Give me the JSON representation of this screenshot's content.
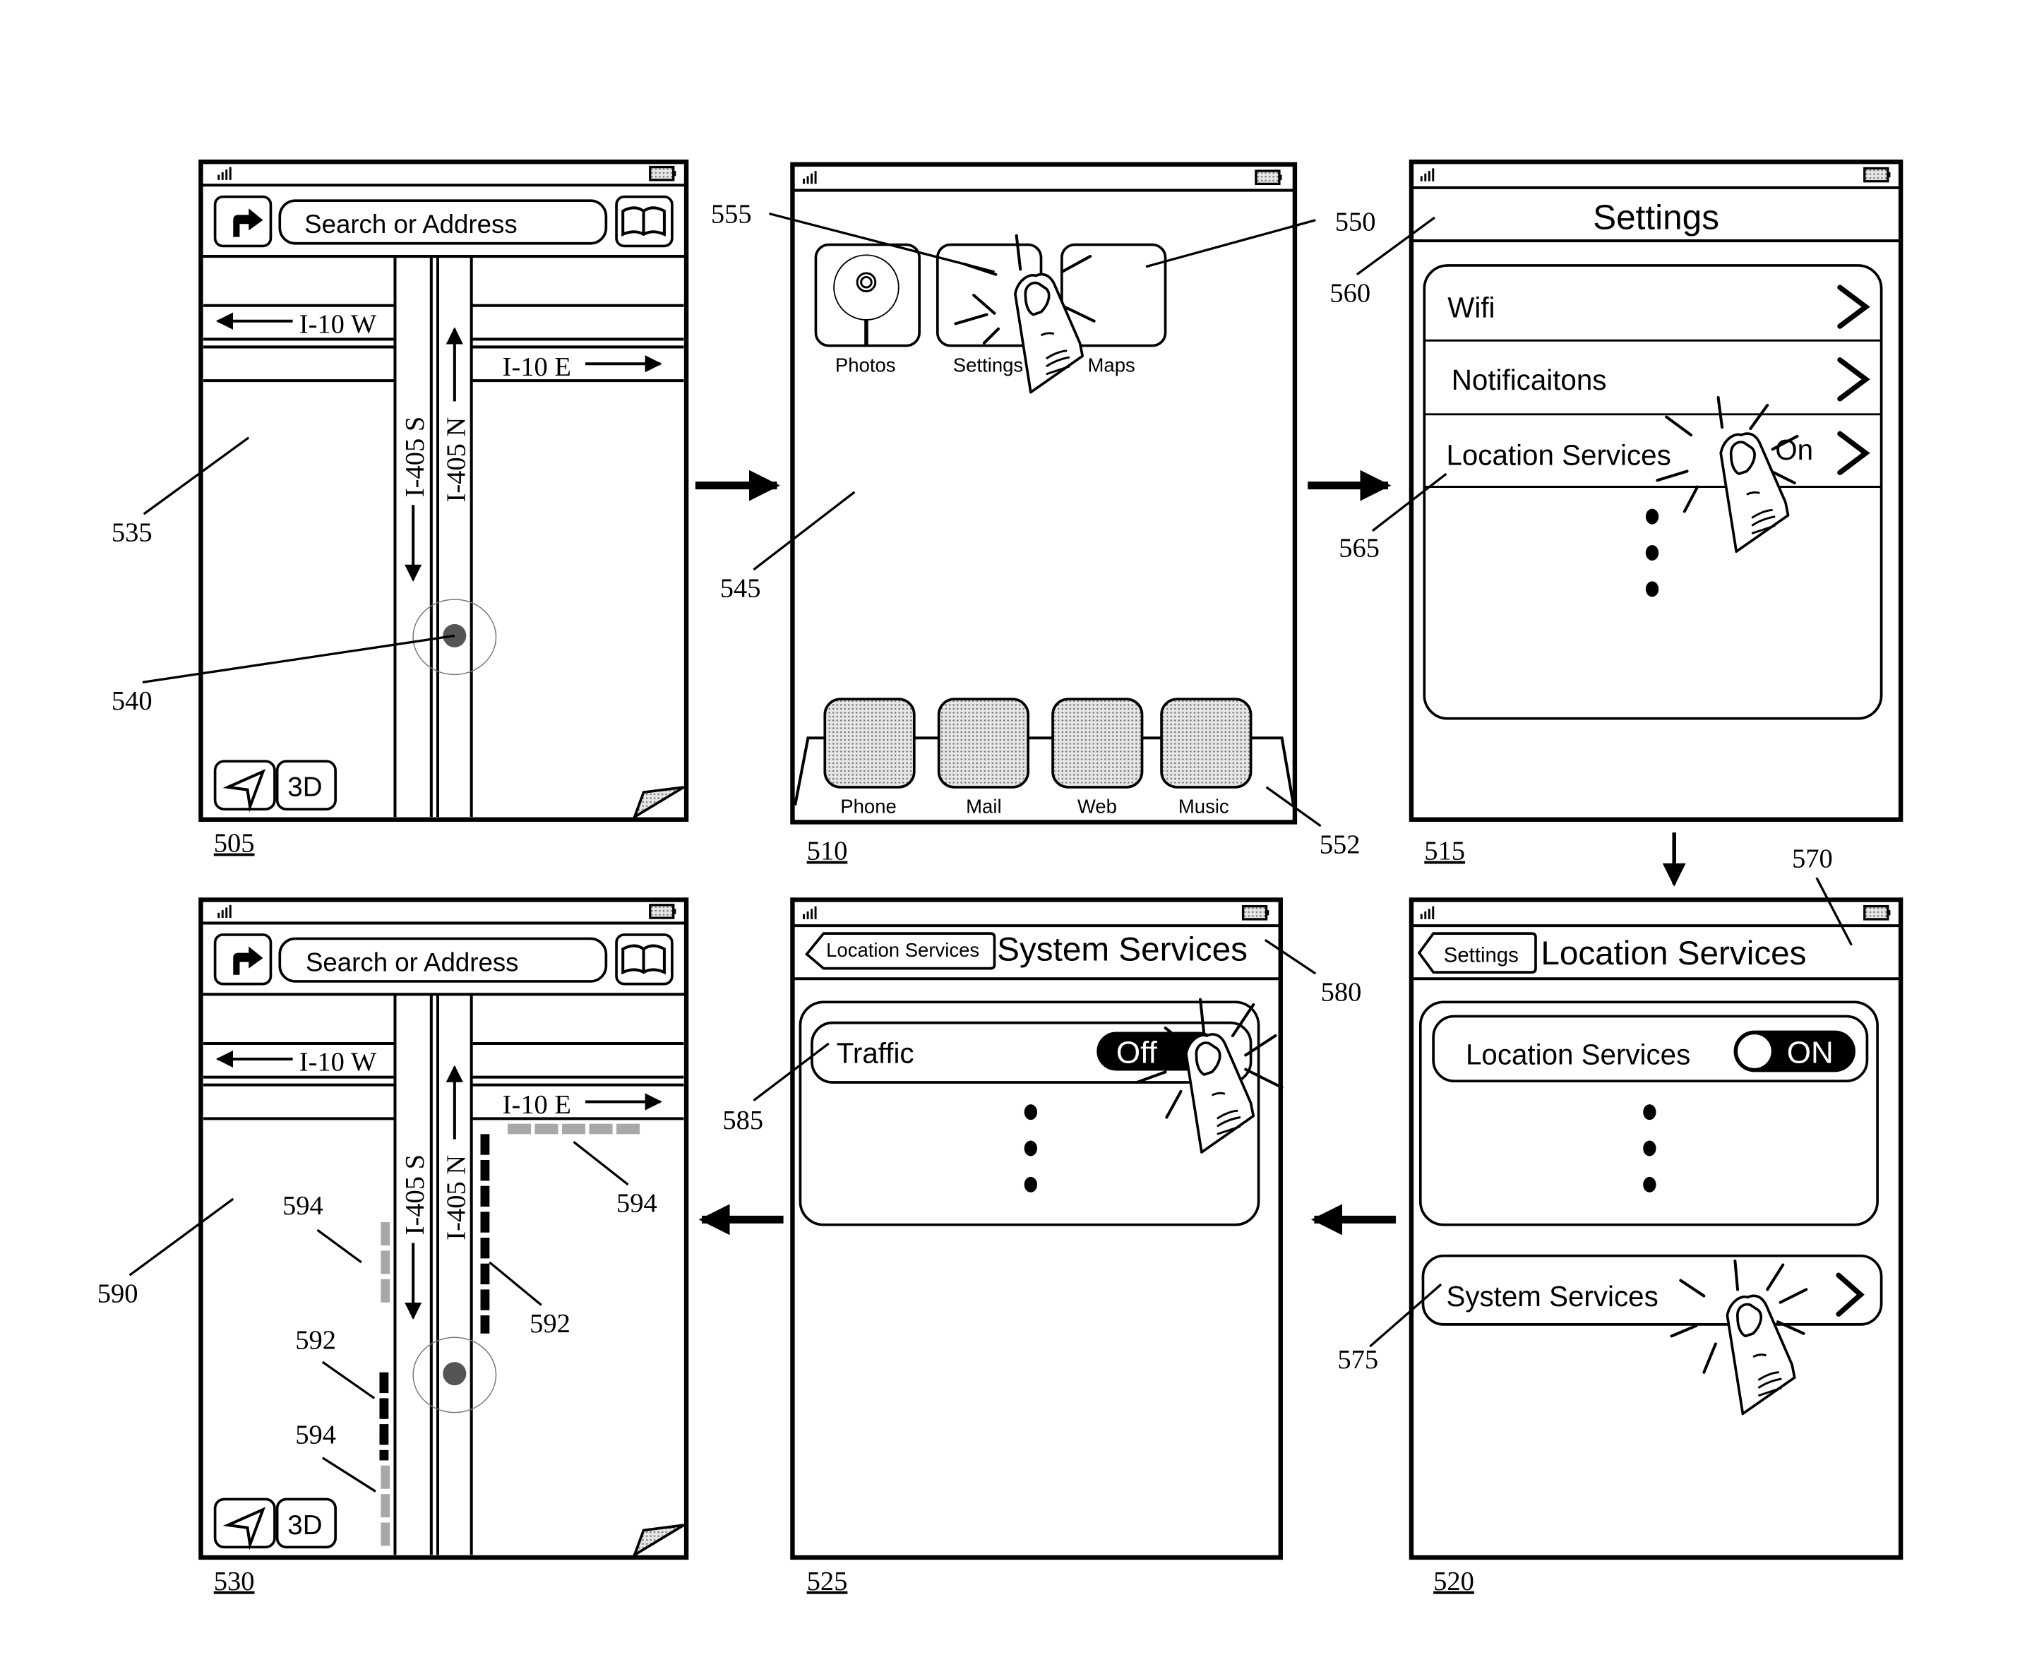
{
  "figure": {
    "flow": [
      "505",
      "510",
      "515",
      "520",
      "525",
      "530"
    ]
  },
  "panels": {
    "p505": {
      "id": "505",
      "search_placeholder": "Search or Address",
      "roads": {
        "w": "I-10 W",
        "e": "I-10 E",
        "s": "I-405 S",
        "n": "I-405 N"
      },
      "btn_3d": "3D",
      "refs": {
        "map": "535",
        "location": "540"
      }
    },
    "p510": {
      "id": "510",
      "apps": [
        "Photos",
        "Settings",
        "Maps"
      ],
      "dock": [
        "Phone",
        "Mail",
        "Web",
        "Music"
      ],
      "refs": {
        "settings": "555",
        "maps": "550",
        "home": "545",
        "dock": "552"
      }
    },
    "p515": {
      "id": "515",
      "title": "Settings",
      "rows": [
        {
          "label": "Wifi",
          "value": ""
        },
        {
          "label": "Notificaitons",
          "value": ""
        },
        {
          "label": "Location Services",
          "value": "On"
        }
      ],
      "refs": {
        "title": "560",
        "location_row": "565"
      }
    },
    "p520": {
      "id": "520",
      "back_label": "Settings",
      "title": "Location Services",
      "toggle_label": "Location Services",
      "toggle_value": "ON",
      "system_services": "System Services",
      "refs": {
        "title": "570",
        "system_services": "575"
      }
    },
    "p525": {
      "id": "525",
      "back_label": "Location Services",
      "title": "System Services",
      "traffic_label": "Traffic",
      "traffic_value": "Off",
      "refs": {
        "title": "580",
        "traffic": "585"
      }
    },
    "p530": {
      "id": "530",
      "search_placeholder": "Search or Address",
      "roads": {
        "w": "I-10 W",
        "e": "I-10 E",
        "s": "I-405 S",
        "n": "I-405 N"
      },
      "btn_3d": "3D",
      "refs": {
        "map": "590",
        "heavy": "592",
        "heavy2": "592",
        "slow1": "594",
        "slow2": "594",
        "slow3": "594"
      }
    }
  }
}
